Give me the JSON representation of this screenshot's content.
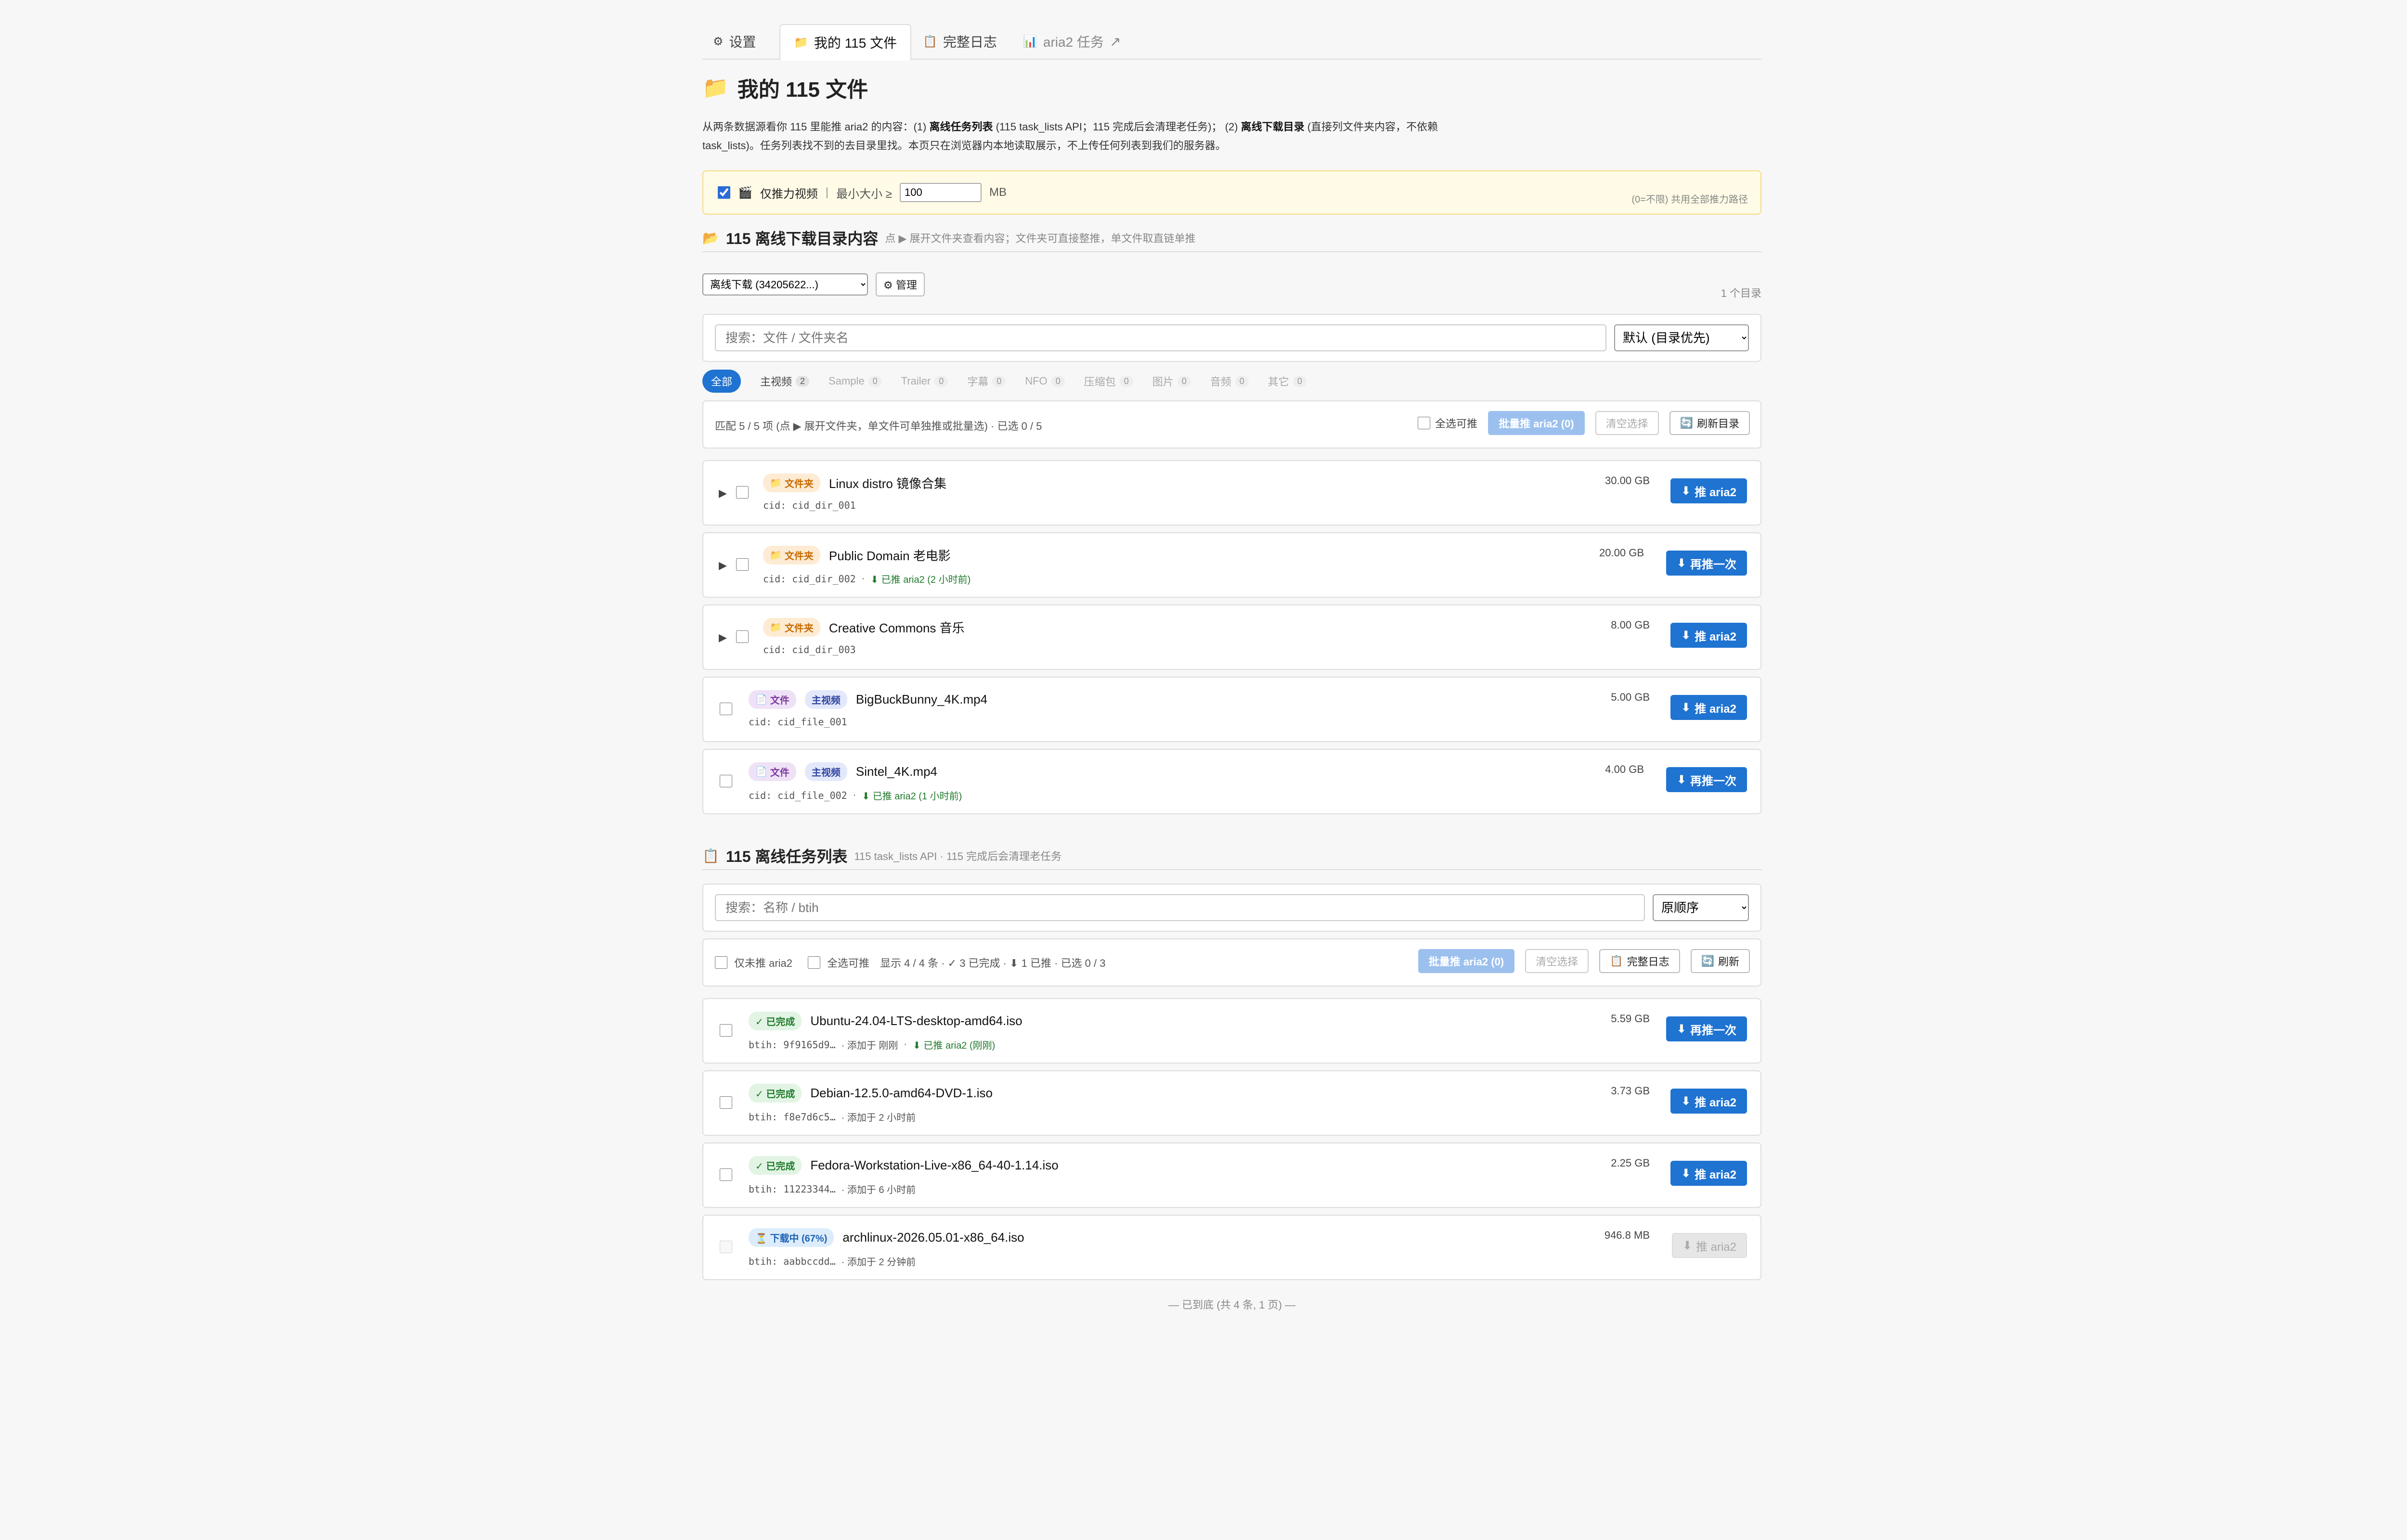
{
  "tabs": [
    {
      "icon": "⚙",
      "label": "设置"
    },
    {
      "icon": "📁",
      "label": "我的 115 文件"
    },
    {
      "icon": "📋",
      "label": "完整日志"
    },
    {
      "icon": "📊",
      "label": "aria2 任务",
      "suffix": "↗"
    }
  ],
  "page": {
    "title": "我的 115 文件",
    "desc_1": "从两条数据源看你 115 里能推 aria2 的内容：(1)",
    "desc_b1": "离线任务列表",
    "desc_2": "(115 task_lists API；115 完成后会清理老任务)；  (2)",
    "desc_b2": "离线下载目录",
    "desc_3": "(直接列文件夹内容，不依赖 task_lists)。任务列表找不到的去目录里找。本页只在浏览器内本地读取展示，不上传任何列表到我们的服务器。"
  },
  "filter": {
    "only_video_label": "仅推力视频",
    "sep": "|",
    "min_size_label": "最小大小 ≥",
    "min_size_value": "100",
    "unit": "MB",
    "hint": "(0=不限) 共用全部推力路径"
  },
  "dir_section": {
    "title": "115 离线下载目录内容",
    "subtitle": "点 ▶ 展开文件夹查看内容；文件夹可直接整推，单文件取直链单推",
    "folder_select": "离线下载 (34205622...)",
    "manage_label": "⚙ 管理",
    "count": "1 个目录",
    "search_placeholder": "搜索：文件 / 文件夹名",
    "sort_label": "默认 (目录优先)",
    "chips": [
      {
        "label": "全部",
        "count": ""
      },
      {
        "label": "主视频",
        "count": "2"
      },
      {
        "label": "Sample",
        "count": "0"
      },
      {
        "label": "Trailer",
        "count": "0"
      },
      {
        "label": "字幕",
        "count": "0"
      },
      {
        "label": "NFO",
        "count": "0"
      },
      {
        "label": "压缩包",
        "count": "0"
      },
      {
        "label": "图片",
        "count": "0"
      },
      {
        "label": "音频",
        "count": "0"
      },
      {
        "label": "其它",
        "count": "0"
      }
    ],
    "summary": "匹配 5 / 5 项 (点 ▶ 展开文件夹，单文件可单独推或批量选) · 已选 0 / 5",
    "select_all": "全选可推",
    "batch_label": "批量推 aria2 (0)",
    "clear_label": "清空选择",
    "refresh_label": "刷新目录",
    "items": [
      {
        "kind": "文件夹",
        "tag": "",
        "name": "Linux distro 镜像合集",
        "cid": "cid: cid_dir_001",
        "pushed": "",
        "size": "30.00 GB",
        "action": "推 aria2"
      },
      {
        "kind": "文件夹",
        "tag": "",
        "name": "Public Domain 老电影",
        "cid": "cid: cid_dir_002",
        "pushed": "已推 aria2 (2 小时前)",
        "size": "20.00 GB",
        "action": "再推一次"
      },
      {
        "kind": "文件夹",
        "tag": "",
        "name": "Creative Commons 音乐",
        "cid": "cid: cid_dir_003",
        "pushed": "",
        "size": "8.00 GB",
        "action": "推 aria2"
      },
      {
        "kind": "文件",
        "tag": "主视频",
        "name": "BigBuckBunny_4K.mp4",
        "cid": "cid: cid_file_001",
        "pushed": "",
        "size": "5.00 GB",
        "action": "推 aria2"
      },
      {
        "kind": "文件",
        "tag": "主视频",
        "name": "Sintel_4K.mp4",
        "cid": "cid: cid_file_002",
        "pushed": "已推 aria2 (1 小时前)",
        "size": "4.00 GB",
        "action": "再推一次"
      }
    ]
  },
  "task_section": {
    "title": "115 离线任务列表",
    "subtitle": "115 task_lists API · 115 完成后会清理老任务",
    "search_placeholder": "搜索：名称 / btih",
    "sort_label": "原顺序",
    "only_unpushed": "仅未推 aria2",
    "select_all": "全选可推",
    "summary": "显示 4 / 4 条 · ✓ 3 已完成 · ⬇ 1 已推 · 已选 0 / 3",
    "batch_label": "批量推 aria2 (0)",
    "clear_label": "清空选择",
    "log_label": "完整日志",
    "refresh_label": "刷新",
    "items": [
      {
        "status": "✓ 已完成",
        "type": "done",
        "name": "Ubuntu-24.04-LTS-desktop-amd64.iso",
        "btih": "btih: 9f9165d9…",
        "added": "· 添加于 刚刚",
        "pushed": "已推 aria2 (刚刚)",
        "size": "5.59 GB",
        "action": "再推一次"
      },
      {
        "status": "✓ 已完成",
        "type": "done",
        "name": "Debian-12.5.0-amd64-DVD-1.iso",
        "btih": "btih: f8e7d6c5…",
        "added": "· 添加于 2 小时前",
        "pushed": "",
        "size": "3.73 GB",
        "action": "推 aria2"
      },
      {
        "status": "✓ 已完成",
        "type": "done",
        "name": "Fedora-Workstation-Live-x86_64-40-1.14.iso",
        "btih": "btih: 11223344…",
        "added": "· 添加于 6 小时前",
        "pushed": "",
        "size": "2.25 GB",
        "action": "推 aria2"
      },
      {
        "status": "⏳ 下载中 (67%)",
        "type": "dl",
        "name": "archlinux-2026.05.01-x86_64.iso",
        "btih": "btih: aabbccdd…",
        "added": "· 添加于 2 分钟前",
        "pushed": "",
        "size": "946.8 MB",
        "action": "推 aria2",
        "progress": 0.67
      }
    ]
  },
  "footer": "— 已到底 (共 4 条, 1 页) —",
  "colors": {
    "primary": "#1f73d1",
    "folder": "#c76a00",
    "file": "#7a3a9e",
    "done": "#1f7a2c",
    "notice_bg": "#fffbe6"
  }
}
